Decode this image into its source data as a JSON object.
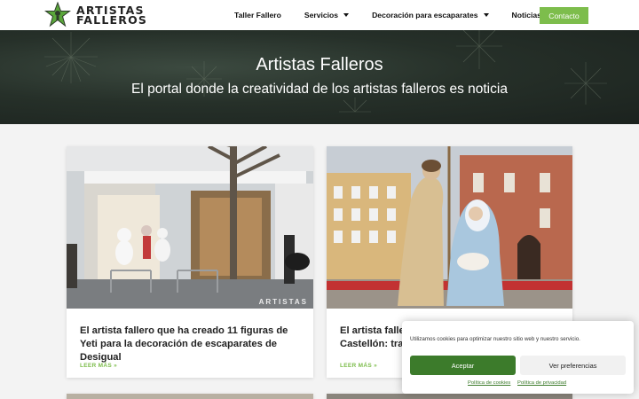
{
  "header": {
    "logo": {
      "line1": "ARTISTAS",
      "line2": "FALLEROS",
      "icon": "star-figure-logo"
    },
    "nav": [
      {
        "label": "Taller Fallero",
        "dropdown": false
      },
      {
        "label": "Servicios",
        "dropdown": true
      },
      {
        "label": "Decoración para escaparates",
        "dropdown": true
      },
      {
        "label": "Noticias",
        "dropdown": false
      }
    ],
    "contact_label": "Contacto"
  },
  "hero": {
    "title": "Artistas Falleros",
    "subtitle": "El portal donde la creatividad de los artistas falleros es noticia"
  },
  "posts": [
    {
      "title": "El artista fallero que ha creado 11 figuras de Yeti para la decoración de escaparates de Desigual",
      "read_more": "LEER MÁS »",
      "image_label": "store-front-yeti-figures",
      "watermark": "ARTISTAS"
    },
    {
      "title": "El artista faller",
      "title_line2": "Castellón: tradi",
      "read_more": "LEER MÁS »",
      "image_label": "nativity-figures-plaza"
    }
  ],
  "cookie_banner": {
    "text": "Utilizamos cookies para optimizar nuestro sitio web y nuestro servicio.",
    "accept_label": "Aceptar",
    "preferences_label": "Ver preferencias",
    "cookie_policy_label": "Política de cookies",
    "privacy_policy_label": "Política de privacidad"
  },
  "colors": {
    "accent": "#7dbd4c",
    "accept_button": "#3c7b2b",
    "hero_bg": "#263029"
  }
}
